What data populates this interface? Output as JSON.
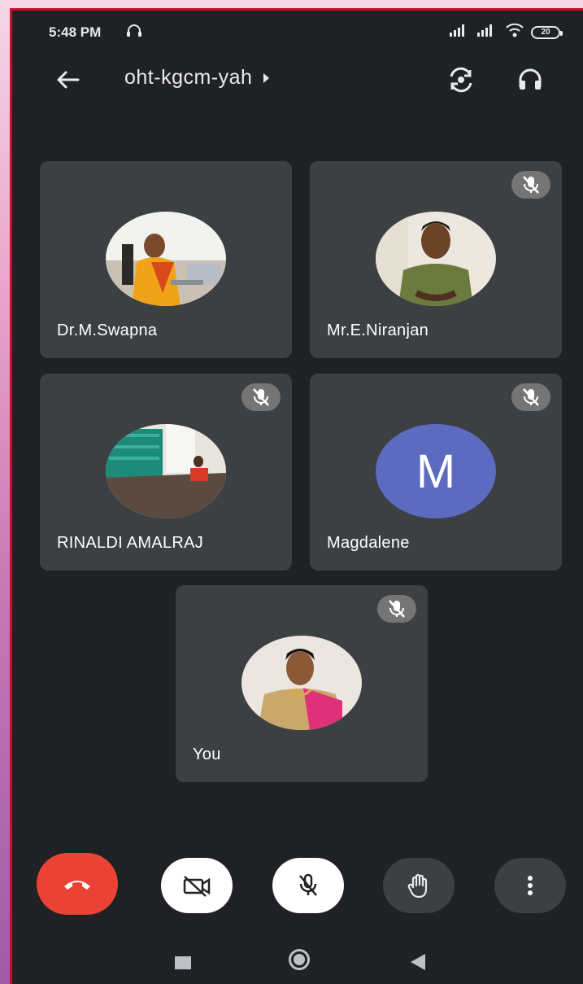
{
  "status_bar": {
    "time": "5:48 PM",
    "battery": "20"
  },
  "header": {
    "meeting_code": "oht-kgcm-yah"
  },
  "participants": [
    {
      "name": "Dr.M.Swapna",
      "muted": false,
      "avatar": "photo"
    },
    {
      "name": "Mr.E.Niranjan",
      "muted": true,
      "avatar": "photo"
    },
    {
      "name": "RINALDI AMALRAJ",
      "muted": true,
      "avatar": "photo"
    },
    {
      "name": "Magdalene",
      "muted": true,
      "avatar": "letter",
      "initial": "M",
      "avatar_color": "#5c6bc0"
    },
    {
      "name": "You",
      "muted": true,
      "avatar": "photo"
    }
  ],
  "controls": {
    "end_call": "end-call-icon",
    "camera": "camera-off-icon",
    "mic": "mic-off-icon",
    "raise_hand": "hand-icon",
    "more": "more-vert-icon"
  },
  "colors": {
    "background": "#202124",
    "tile": "#3c4043",
    "end_call": "#ea4335",
    "accent_avatar": "#5c6bc0"
  }
}
